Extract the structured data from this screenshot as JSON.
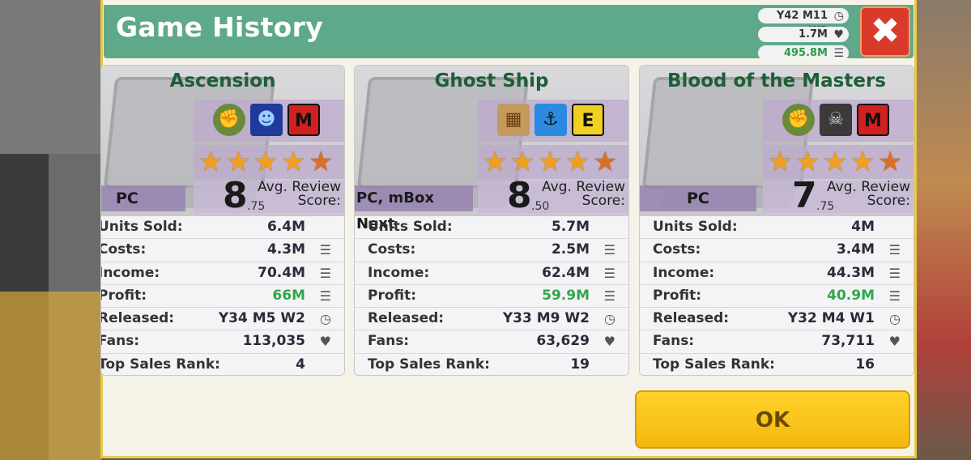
{
  "window": {
    "title": "Game History"
  },
  "header_stats": {
    "date": "Y42 M11 W2",
    "fans": "1.7M",
    "money": "495.8M"
  },
  "icons": {
    "close": "close-x-icon",
    "clock": "clock-icon",
    "heart": "heart-icon",
    "coins": "coins-icon",
    "star": "star-icon"
  },
  "colors": {
    "accent_green": "#5ea98a",
    "profit_green": "#2ea84a",
    "ok_button": "#ffd22a",
    "close_button": "#d93a2a"
  },
  "score_labels": {
    "line1": "Avg. Review",
    "line2": "Score:"
  },
  "row_labels": {
    "units": "Units Sold:",
    "costs": "Costs:",
    "income": "Income:",
    "profit": "Profit:",
    "released": "Released:",
    "fans": "Fans:",
    "rank": "Top Sales Rank:"
  },
  "games": [
    {
      "title": "Ascension",
      "genre_icons": [
        "fist-icon",
        "alien-icon",
        "rating-m-icon"
      ],
      "rating_letter": "M",
      "stars": 4.5,
      "score_whole": "8",
      "score_decimal": ".75",
      "platform": "PC",
      "units_sold": "6.4M",
      "costs": "4.3M",
      "income": "70.4M",
      "profit": "66M",
      "released": "Y34 M5 W2",
      "fans": "113,035",
      "top_sales_rank": "4"
    },
    {
      "title": "Ghost Ship",
      "genre_icons": [
        "map-icon",
        "pirate-ship-icon",
        "rating-e-icon"
      ],
      "rating_letter": "E",
      "stars": 4.5,
      "score_whole": "8",
      "score_decimal": ".50",
      "platform": "PC, mBox Next",
      "units_sold": "5.7M",
      "costs": "2.5M",
      "income": "62.4M",
      "profit": "59.9M",
      "released": "Y33 M9 W2",
      "fans": "63,629",
      "top_sales_rank": "19"
    },
    {
      "title": "Blood of the Masters",
      "genre_icons": [
        "fist-icon",
        "zombie-icon",
        "rating-m-icon"
      ],
      "rating_letter": "M",
      "stars": 4.5,
      "score_whole": "7",
      "score_decimal": ".75",
      "platform": "PC",
      "units_sold": "4M",
      "costs": "3.4M",
      "income": "44.3M",
      "profit": "40.9M",
      "released": "Y32 M4 W1",
      "fans": "73,711",
      "top_sales_rank": "16"
    }
  ],
  "buttons": {
    "ok": "OK"
  }
}
